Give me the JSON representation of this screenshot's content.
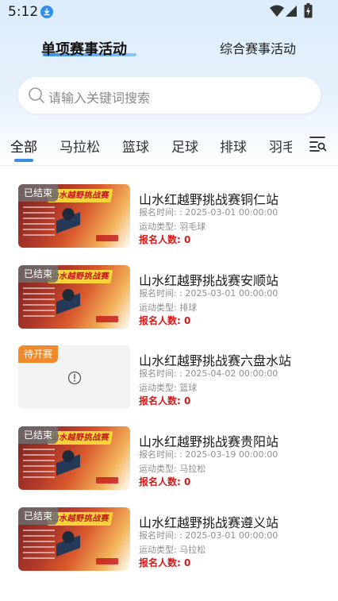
{
  "status_bar": {
    "time": "5:12"
  },
  "header": {
    "tabs": [
      {
        "label": "单项赛事活动",
        "active": true
      },
      {
        "label": "综合赛事活动",
        "active": false
      }
    ]
  },
  "search": {
    "placeholder": "请输入关键词搜索"
  },
  "categories": {
    "items": [
      "全部",
      "马拉松",
      "篮球",
      "足球",
      "排球",
      "羽毛"
    ],
    "active_index": 0
  },
  "colors": {
    "accent": "#3a8ee6",
    "count_red": "#d31b1b",
    "badge_ended": "#6e6e6e",
    "badge_pending": "#f08a2c"
  },
  "events": [
    {
      "status": "已结束",
      "title": "山水红越野挑战赛铜仁站",
      "time_label": "报名时间: :",
      "time": "2025-03-01 00:00:00",
      "type_label": "运动类型:",
      "type": "羽毛球",
      "count_label": "报名人数:",
      "count": "0",
      "image": "poster",
      "poster_text": "山水越野挑战赛"
    },
    {
      "status": "已结束",
      "title": "山水红越野挑战赛安顺站",
      "time_label": "报名时间: :",
      "time": "2025-03-01 00:00:00",
      "type_label": "运动类型:",
      "type": "排球",
      "count_label": "报名人数:",
      "count": "0",
      "image": "poster",
      "poster_text": "山水越野挑战赛"
    },
    {
      "status": "待开赛",
      "title": "山水红越野挑战赛六盘水站",
      "time_label": "报名时间: :",
      "time": "2025-04-02 00:00:00",
      "type_label": "运动类型:",
      "type": "篮球",
      "count_label": "报名人数:",
      "count": "0",
      "image": "placeholder"
    },
    {
      "status": "已结束",
      "title": "山水红越野挑战赛贵阳站",
      "time_label": "报名时间: :",
      "time": "2025-03-19 00:00:00",
      "type_label": "运动类型:",
      "type": "马拉松",
      "count_label": "报名人数:",
      "count": "0",
      "image": "poster",
      "poster_text": "山水越野挑战赛"
    },
    {
      "status": "已结束",
      "title": "山水红越野挑战赛遵义站",
      "time_label": "报名时间: :",
      "time": "2025-03-01 00:00:00",
      "type_label": "运动类型:",
      "type": "马拉松",
      "count_label": "报名人数:",
      "count": "0",
      "image": "poster",
      "poster_text": "山水越野挑战赛"
    }
  ]
}
